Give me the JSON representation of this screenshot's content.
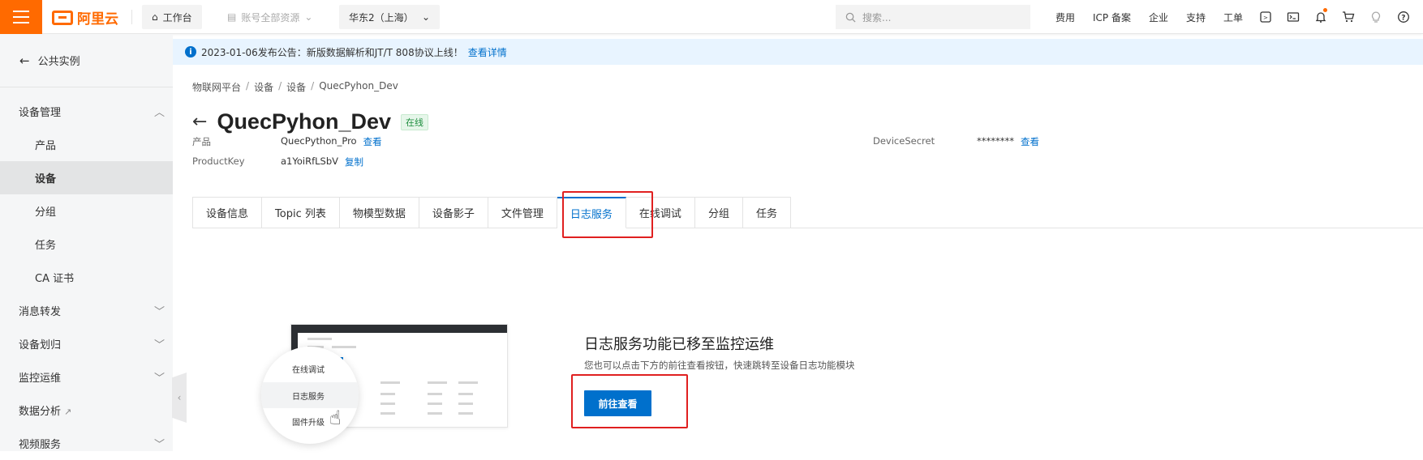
{
  "colors": {
    "brand": "#ff6a00",
    "primary": "#0070cc",
    "highlight": "#e02020",
    "online": "#1e8e3e"
  },
  "topbar": {
    "logo_text": "阿里云",
    "workbench": "工作台",
    "account_resources": "账号全部资源",
    "region": "华东2（上海）",
    "search_placeholder": "搜索...",
    "links": [
      "费用",
      "ICP 备案",
      "企业",
      "支持",
      "工单"
    ],
    "icons": [
      "cloud-shell-icon",
      "terminal-icon",
      "bell-icon",
      "cart-icon",
      "bulb-icon",
      "help-icon"
    ]
  },
  "sidebar": {
    "back_label": "公共实例",
    "items": [
      {
        "label": "设备管理",
        "type": "group",
        "expanded": true
      },
      {
        "label": "产品",
        "type": "sub"
      },
      {
        "label": "设备",
        "type": "sub",
        "active": true
      },
      {
        "label": "分组",
        "type": "sub"
      },
      {
        "label": "任务",
        "type": "sub"
      },
      {
        "label": "CA 证书",
        "type": "sub"
      },
      {
        "label": "消息转发",
        "type": "group"
      },
      {
        "label": "设备划归",
        "type": "group"
      },
      {
        "label": "监控运维",
        "type": "group"
      },
      {
        "label": "数据分析",
        "type": "external"
      },
      {
        "label": "视频服务",
        "type": "group"
      }
    ]
  },
  "notice": {
    "text": "2023-01-06发布公告：新版数据解析和JT/T 808协议上线！",
    "link": "查看详情"
  },
  "breadcrumb": [
    "物联网平台",
    "设备",
    "设备",
    "QuecPyhon_Dev"
  ],
  "device": {
    "name": "QuecPyhon_Dev",
    "status": "在线",
    "product_label": "产品",
    "product_value": "QuecPython_Pro",
    "product_link": "查看",
    "productkey_label": "ProductKey",
    "productkey_value": "a1YoiRfLSbV",
    "productkey_link": "复制",
    "secret_label": "DeviceSecret",
    "secret_value": "********",
    "secret_link": "查看"
  },
  "tabs": [
    "设备信息",
    "Topic 列表",
    "物模型数据",
    "设备影子",
    "文件管理",
    "日志服务",
    "在线调试",
    "分组",
    "任务"
  ],
  "active_tab": 5,
  "illustration": {
    "options": [
      "在线调试",
      "日志服务",
      "固件升级"
    ]
  },
  "empty_state": {
    "title": "日志服务功能已移至监控运维",
    "desc": "您也可以点击下方的前往查看按钮，快速跳转至设备日志功能模块",
    "button": "前往查看"
  }
}
